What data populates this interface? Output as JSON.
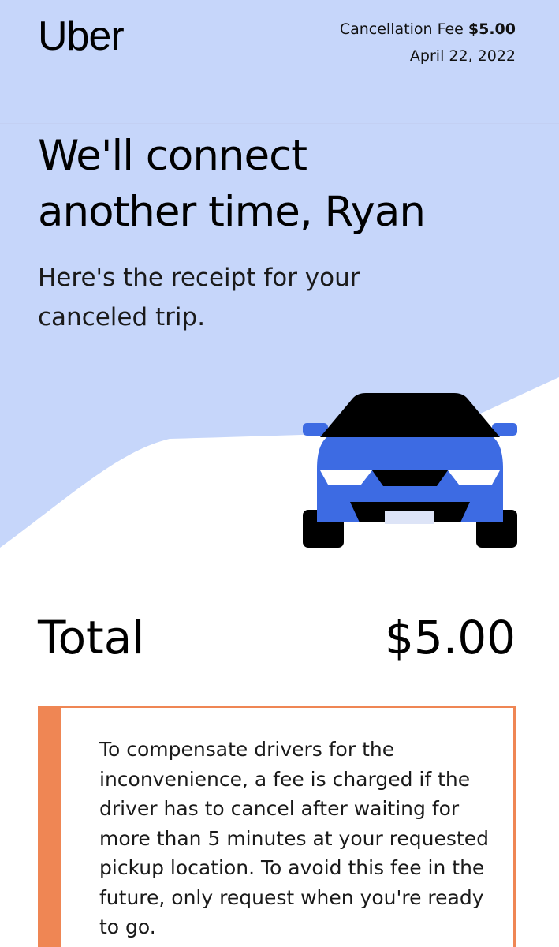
{
  "header": {
    "logo_text": "Uber",
    "fee_label": "Cancellation Fee",
    "fee_amount": "$5.00",
    "date": "April 22, 2022"
  },
  "hero": {
    "headline_line1": "We'll connect",
    "headline_line2": "another time, Ryan",
    "subhead": "Here's the receipt for your canceled trip.",
    "illustration_icon": "car-front-icon"
  },
  "summary": {
    "total_label": "Total",
    "total_amount": "$5.00"
  },
  "notice": {
    "text": "To compensate drivers for the inconvenience, a fee is charged if the driver has to cancel after waiting for more than 5 minutes at your requested pickup location. To avoid this fee in the future, only request when you're ready to go."
  },
  "colors": {
    "hero_background": "#c6d6fa",
    "car_body": "#3d6be3",
    "notice_accent": "#ef8654",
    "text": "#000000"
  }
}
